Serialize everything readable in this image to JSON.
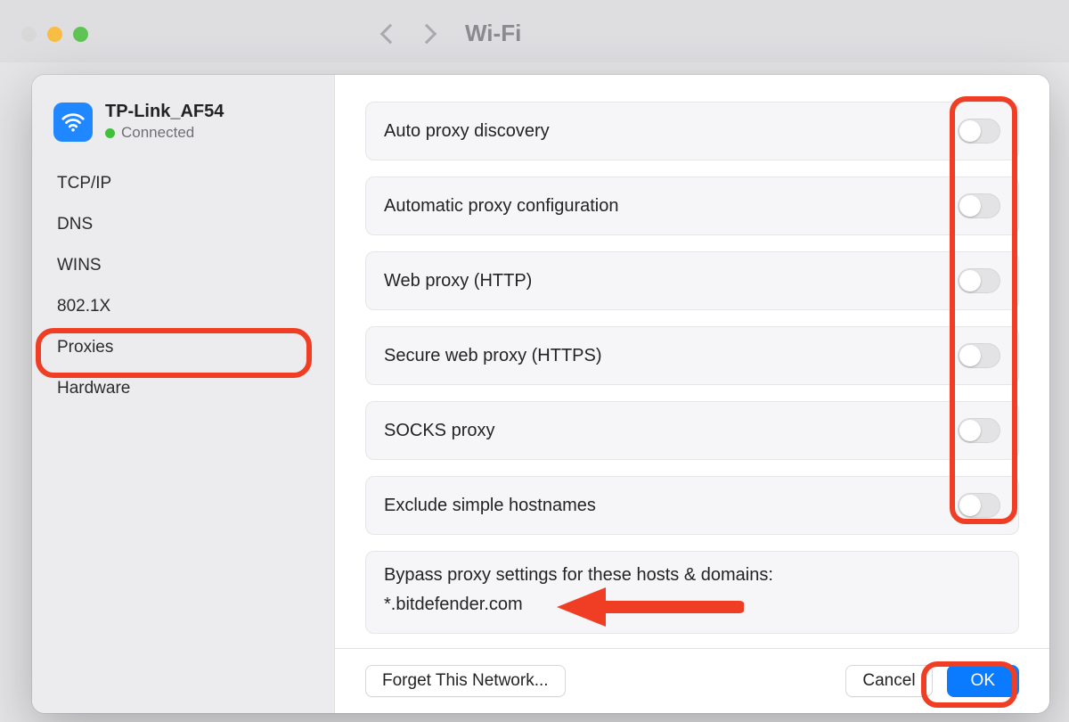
{
  "background": {
    "title": "Wi-Fi"
  },
  "network": {
    "name": "TP-Link_AF54",
    "status": "Connected"
  },
  "sidebar": {
    "items": [
      {
        "label": "TCP/IP"
      },
      {
        "label": "DNS"
      },
      {
        "label": "WINS"
      },
      {
        "label": "802.1X"
      },
      {
        "label": "Proxies"
      },
      {
        "label": "Hardware"
      }
    ]
  },
  "proxies": {
    "rows": [
      {
        "label": "Auto proxy discovery"
      },
      {
        "label": "Automatic proxy configuration"
      },
      {
        "label": "Web proxy (HTTP)"
      },
      {
        "label": "Secure web proxy (HTTPS)"
      },
      {
        "label": "SOCKS proxy"
      },
      {
        "label": "Exclude simple hostnames"
      }
    ],
    "bypass_label": "Bypass proxy settings for these hosts & domains:",
    "bypass_value": "*.bitdefender.com"
  },
  "footer": {
    "forget": "Forget This Network...",
    "cancel": "Cancel",
    "ok": "OK"
  }
}
